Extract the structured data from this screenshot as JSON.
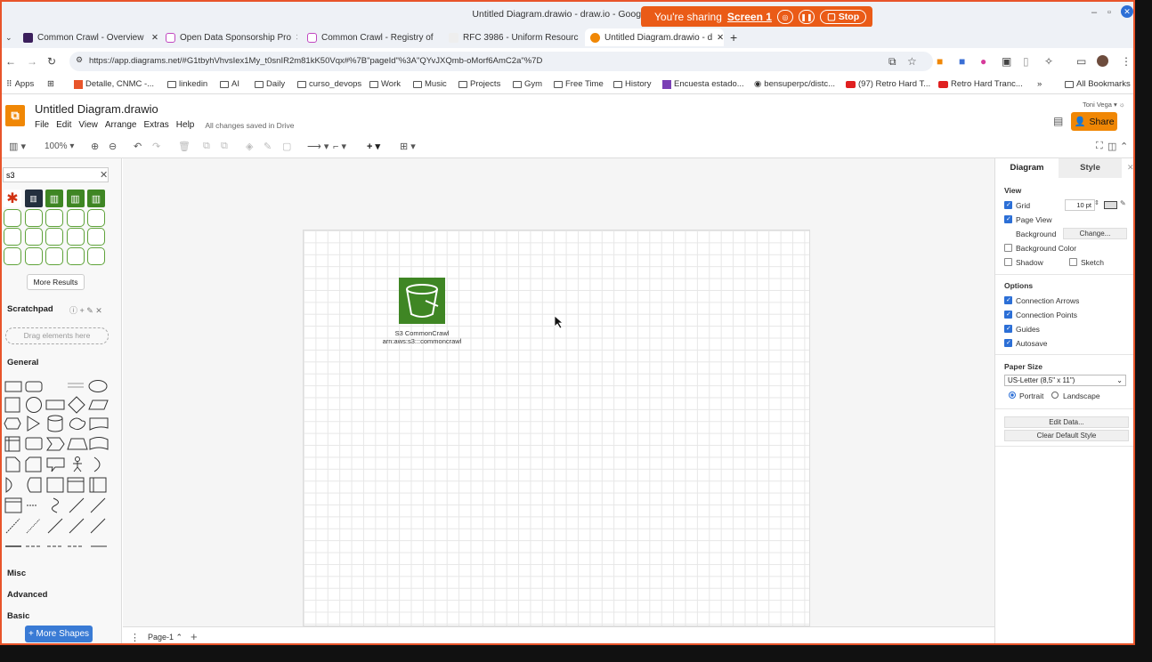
{
  "window": {
    "title": "Untitled Diagram.drawio - draw.io - Google Ch",
    "sharing_text": "You're sharing",
    "sharing_screen": "Screen 1",
    "stop_label": "Stop"
  },
  "tabs": [
    {
      "label": "Common Crawl - Overview"
    },
    {
      "label": "Open Data Sponsorship Pro"
    },
    {
      "label": "Common Crawl - Registry of"
    },
    {
      "label": "RFC 3986 - Uniform Resourc"
    },
    {
      "label": "Untitled Diagram.drawio - d",
      "active": true
    }
  ],
  "address": {
    "url": "https://app.diagrams.net/#G1tbyhVhvsIex1My_t0snIR2m81kK50Vqx#%7B\"pageId\"%3A\"QYvJXQmb-oMorf6AmC2a\"%7D"
  },
  "bookmarks": [
    "Apps",
    "Detalle, CNMC -...",
    "linkedin",
    "AI",
    "Daily",
    "curso_devops",
    "Work",
    "Music",
    "Projects",
    "Gym",
    "Free Time",
    "History",
    "Encuesta estado...",
    "bensuperpc/distc...",
    "(97) Retro Hard T...",
    "Retro Hard Tranc...",
    "All Bookmarks"
  ],
  "drawio": {
    "file_title": "Untitled Diagram.drawio",
    "menu": [
      "File",
      "Edit",
      "View",
      "Arrange",
      "Extras",
      "Help"
    ],
    "saved_status": "All changes saved in Drive",
    "share_label": "Share",
    "user_name": "Toni Vega",
    "zoom": "100%"
  },
  "left_panel": {
    "search_value": "s3",
    "more_results": "More Results",
    "scratchpad": "Scratchpad",
    "drag_here": "Drag elements here",
    "general": "General",
    "misc": "Misc",
    "advanced": "Advanced",
    "basic": "Basic",
    "more_shapes": "+ More Shapes"
  },
  "canvas": {
    "shape_label_line1": "S3 CommonCrawl",
    "shape_label_line2": "arn:aws:s3:::commoncrawl"
  },
  "bottom": {
    "page_tab": "Page-1"
  },
  "right_panel": {
    "tab_diagram": "Diagram",
    "tab_style": "Style",
    "view_heading": "View",
    "grid": "Grid",
    "grid_size": "10 pt",
    "page_view": "Page View",
    "background": "Background",
    "change": "Change...",
    "background_color": "Background Color",
    "shadow": "Shadow",
    "sketch": "Sketch",
    "options_heading": "Options",
    "connection_arrows": "Connection Arrows",
    "connection_points": "Connection Points",
    "guides": "Guides",
    "autosave": "Autosave",
    "paper_size_heading": "Paper Size",
    "paper_size": "US-Letter (8,5\" x 11\")",
    "portrait": "Portrait",
    "landscape": "Landscape",
    "edit_data": "Edit Data...",
    "clear_default_style": "Clear Default Style"
  }
}
